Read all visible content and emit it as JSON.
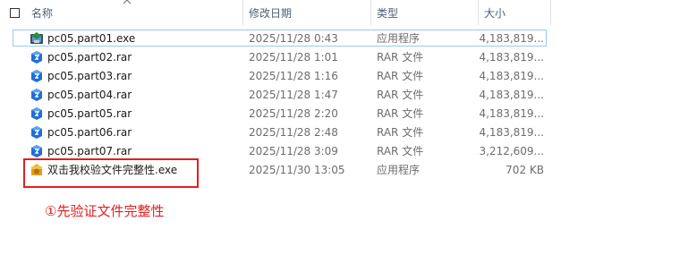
{
  "header": {
    "col_name": "名称",
    "col_date": "修改日期",
    "col_type": "类型",
    "col_size": "大小"
  },
  "files": [
    {
      "name": "pc05.part01.exe",
      "date": "2025/11/28 0:43",
      "type": "应用程序",
      "size": "4,183,819...",
      "icon": "installer-exe-icon"
    },
    {
      "name": "pc05.part02.rar",
      "date": "2025/11/28 1:01",
      "type": "RAR 文件",
      "size": "4,183,819...",
      "icon": "rar-archive-icon"
    },
    {
      "name": "pc05.part03.rar",
      "date": "2025/11/28 1:16",
      "type": "RAR 文件",
      "size": "4,183,819...",
      "icon": "rar-archive-icon"
    },
    {
      "name": "pc05.part04.rar",
      "date": "2025/11/28 1:47",
      "type": "RAR 文件",
      "size": "4,183,819...",
      "icon": "rar-archive-icon"
    },
    {
      "name": "pc05.part05.rar",
      "date": "2025/11/28 2:20",
      "type": "RAR 文件",
      "size": "4,183,819...",
      "icon": "rar-archive-icon"
    },
    {
      "name": "pc05.part06.rar",
      "date": "2025/11/28 2:48",
      "type": "RAR 文件",
      "size": "4,183,819...",
      "icon": "rar-archive-icon"
    },
    {
      "name": "pc05.part07.rar",
      "date": "2025/11/28 3:09",
      "type": "RAR 文件",
      "size": "3,212,609...",
      "icon": "rar-archive-icon"
    },
    {
      "name": "双击我校验文件完整性.exe",
      "date": "2025/11/30 13:05",
      "type": "应用程序",
      "size": "702 KB",
      "icon": "verify-exe-icon"
    }
  ],
  "annotation": {
    "text": "①先验证文件完整性"
  },
  "colors": {
    "annotation_red": "#e02020",
    "focus_border": "#99c9ef",
    "rar_blue": "#1e6fd9",
    "header_text": "#4c607a"
  }
}
